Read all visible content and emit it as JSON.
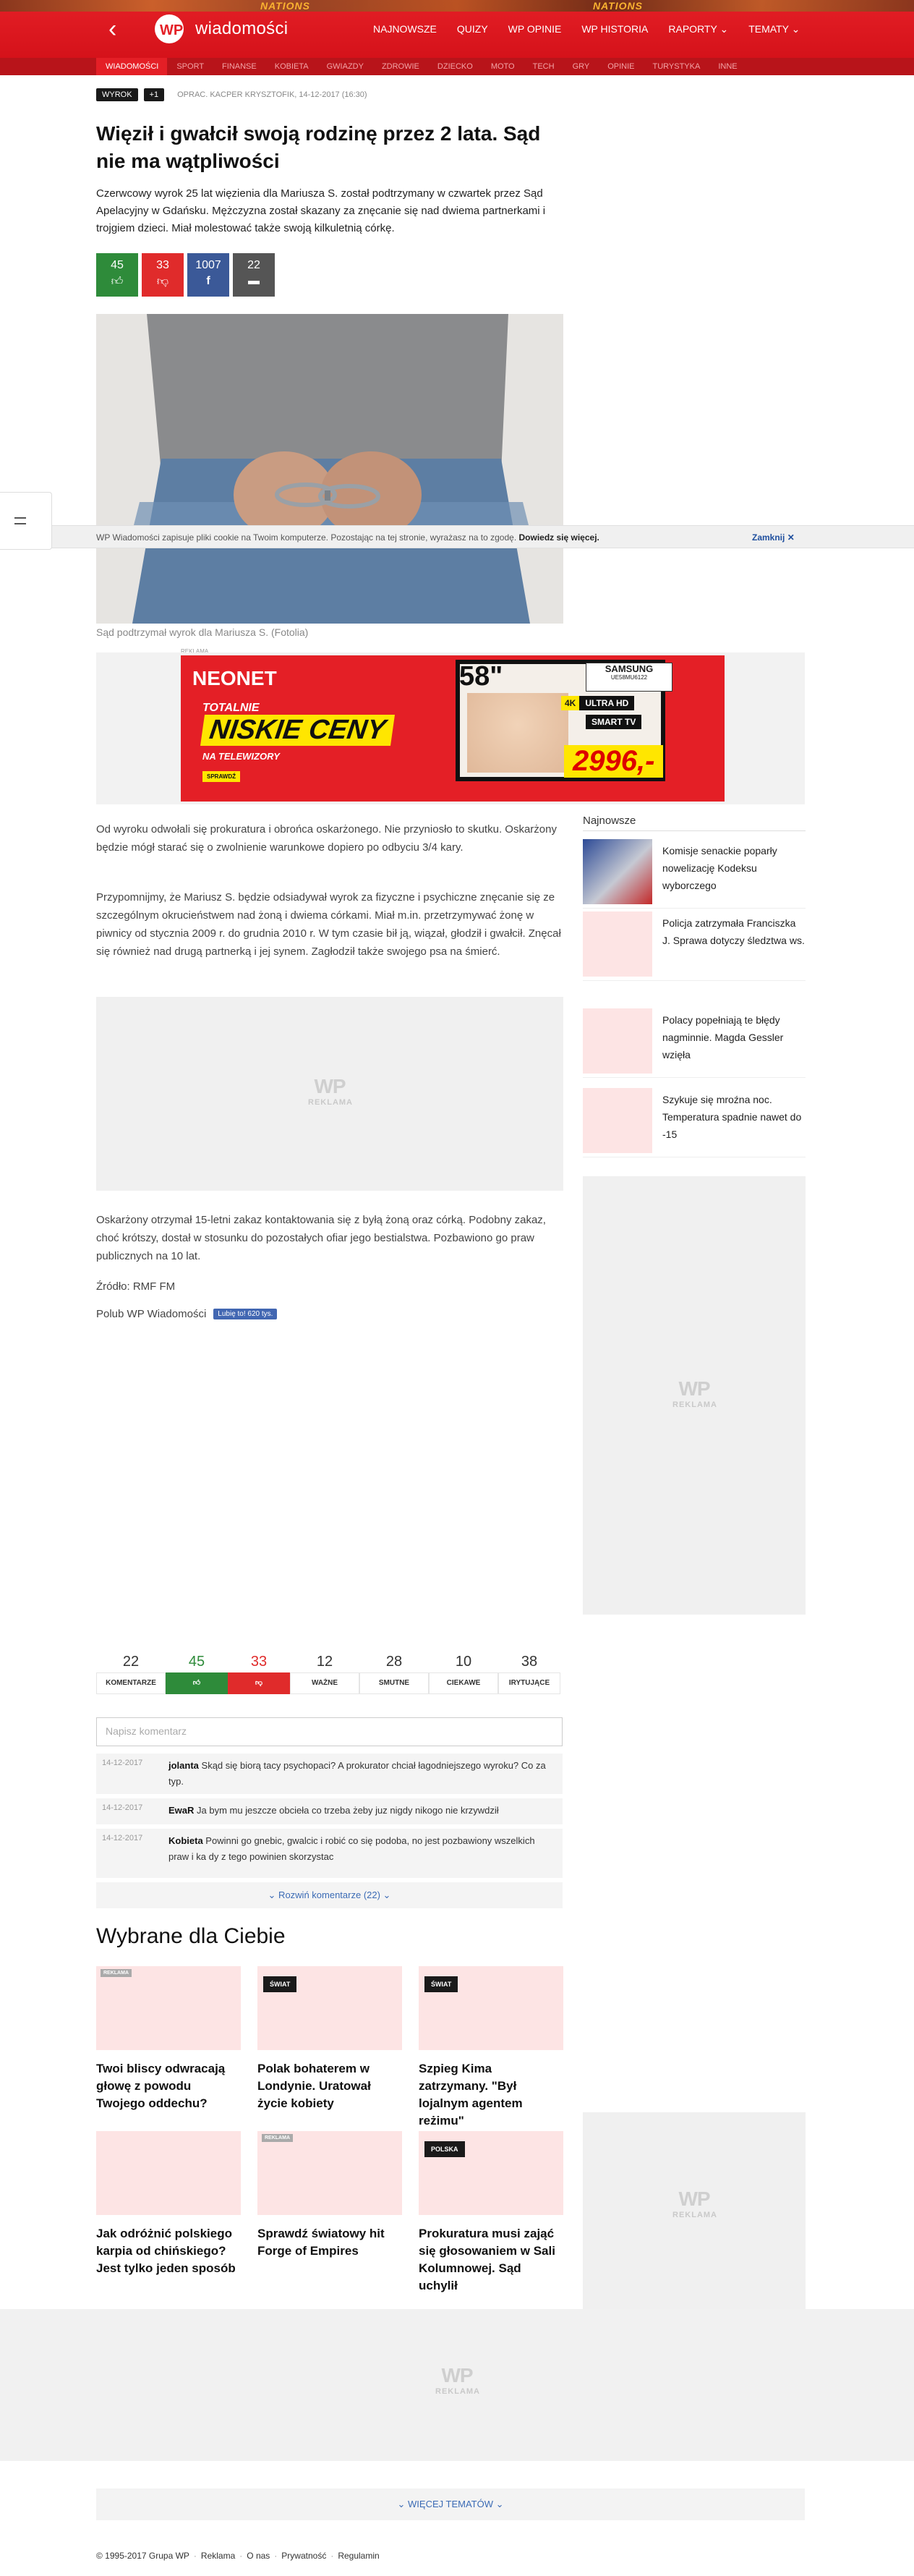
{
  "banner": {
    "game_text_left": "NATIONS",
    "game_text_right": "NATIONS"
  },
  "header": {
    "logo_text": "wiadomości",
    "nav": [
      "NAJNOWSZE",
      "QUIZY",
      "WP OPINIE",
      "WP HISTORIA",
      "RAPORTY",
      "TEMATY"
    ],
    "subnav": [
      "WIADOMOŚCI",
      "SPORT",
      "FINANSE",
      "KOBIETA",
      "GWIAZDY",
      "ZDROWIE",
      "DZIECKO",
      "MOTO",
      "TECH",
      "GRY",
      "OPINIE",
      "TURYSTYKA",
      "INNE"
    ]
  },
  "article": {
    "tag": "WYROK",
    "plus": "+1",
    "byline": "OPRAC. KACPER KRYSZTOFIK, 14-12-2017 (16:30)",
    "headline": "Więził i gwałcił swoją rodzinę przez 2 lata. Sąd nie ma wątpliwości",
    "lead": "Czerwcowy wyrok 25 lat więzienia dla Mariusza S. został podtrzymany w czwartek przez Sąd Apelacyjny w Gdańsku. Mężczyzna został skazany za znęcanie się nad dwiema partnerkami i trojgiem dzieci. Miał molestować także swoją kilkuletnią córkę.",
    "reactions": {
      "likes": "45",
      "dislikes": "33",
      "shares": "1007",
      "comments": "22"
    },
    "caption": "Sąd podtrzymał wyrok dla Mariusza S. (Fotolia)",
    "paragraphs": [
      "Od wyroku odwołali się prokuratura i obrońca oskarżonego. Nie przyniosło to skutku. Oskarżony będzie mógł starać się o zwolnienie warunkowe dopiero po odbyciu 3/4 kary.",
      "Przypomnijmy, że Mariusz S. będzie odsiadywał wyrok za fizyczne i psychiczne znęcanie się ze szczególnym okrucieństwem nad żoną i dwiema córkami. Miał m.in. przetrzymywać żonę w piwnicy od stycznia 2009 r. do grudnia 2010 r. W tym czasie bił ją, wiązał, głodził i gwałcił. Znęcał się również nad drugą partnerką i jej synem. Zagłodził także swojego psa na śmierć.",
      "Oskarżony otrzymał 15-letni zakaz kontaktowania się z byłą żoną oraz córką. Podobny zakaz, choć krótszy, dostał w stosunku do pozostałych ofiar jego bestialstwa. Pozbawiono go praw publicznych na 10 lat.",
      "Źródło: RMF FM"
    ],
    "polub": "Polub WP Wiadomości",
    "fb_button": "Lubię to! 620 tys."
  },
  "cookie": {
    "text": "WP Wiadomości zapisuje pliki cookie na Twoim komputerze. Pozostając na tej stronie, wyrażasz na to zgodę.",
    "link": "Dowiedz się więcej.",
    "close": "Zamknij"
  },
  "ads": {
    "label": "REKLAMA",
    "neonet_brand": "NEONET",
    "neonet_line1": "TOTALNIE",
    "neonet_line2": "NISKIE CENY",
    "neonet_line3": "NA TELEWIZORY",
    "neonet_cta": "SPRAWDŹ",
    "tv_size": "58\"",
    "tv_brand": "SAMSUNG",
    "tv_model": "UE58MU6122",
    "tv_badge1": "4K",
    "tv_badge2": "ULTRA HD",
    "tv_badge3": "SMART TV",
    "price": "2996,-",
    "wp_word": "WP",
    "reklama": "REKLAMA"
  },
  "sidebar": {
    "title": "Najnowsze",
    "items": [
      "Komisje senackie poparły nowelizację Kodeksu wyborczego",
      "Policja zatrzymała Franciszka J. Sprawa dotyczy śledztwa ws.",
      "Polacy popełniają te błędy nagminnie. Magda Gessler wzięła",
      "Szykuje się mroźna noc. Temperatura spadnie nawet do -15"
    ]
  },
  "comments": {
    "stats": [
      {
        "n": "22",
        "label": "KOMENTARZE"
      },
      {
        "n": "45",
        "label": "like"
      },
      {
        "n": "33",
        "label": "dislike"
      },
      {
        "n": "12",
        "label": "WAŻNE"
      },
      {
        "n": "28",
        "label": "SMUTNE"
      },
      {
        "n": "10",
        "label": "CIEKAWE"
      },
      {
        "n": "38",
        "label": "IRYTUJĄCE"
      }
    ],
    "placeholder": "Napisz komentarz",
    "items": [
      {
        "date": "14-12-2017",
        "author": "jolanta",
        "text": "Skąd się biorą tacy psychopaci? A prokurator chciał łagodniejszego wyroku? Co za typ."
      },
      {
        "date": "14-12-2017",
        "author": "EwaR",
        "text": "Ja bym mu jeszcze obcieła co trzeba żeby juz nigdy nikogo nie krzywdził"
      },
      {
        "date": "14-12-2017",
        "author": "Kobieta",
        "text": "Powinni go gnebic, gwalcic i robić co się podoba, no jest pozbawiony wszelkich praw i ka dy z tego powinien skorzystac"
      }
    ],
    "expand": "⌄ Rozwiń komentarze (22) ⌄"
  },
  "picked": {
    "title": "Wybrane dla Ciebie",
    "cards": [
      {
        "badge": "REKLAMA",
        "title": "Twoi bliscy odwracają głowę z powodu Twojego oddechu?"
      },
      {
        "badge": "ŚWIAT",
        "title": "Polak bohaterem w Londynie. Uratował życie kobiety"
      },
      {
        "badge": "ŚWIAT",
        "title": "Szpieg Kima zatrzymany. \"Był lojalnym agentem reżimu\""
      },
      {
        "badge": "",
        "title": "Jak odróżnić polskiego karpia od chińskiego? Jest tylko jeden sposób"
      },
      {
        "badge": "REKLAMA",
        "title": "Sprawdź światowy hit Forge of Empires"
      },
      {
        "badge": "POLSKA",
        "title": "Prokuratura musi zająć się głosowaniem w Sali Kolumnowej. Sąd uchylił"
      }
    ]
  },
  "more_topics": "⌄ WIĘCEJ TEMATÓW ⌄",
  "footer": {
    "copy": "© 1995-2017 Grupa WP",
    "links": [
      "Reklama",
      "O nas",
      "Prywatność",
      "Regulamin"
    ]
  },
  "colors": {
    "brand_red": "#e41f26",
    "like_green": "#2e8b3a",
    "dislike_red": "#e02b2b",
    "fb_blue": "#3b5998",
    "comment_grey": "#555555"
  }
}
